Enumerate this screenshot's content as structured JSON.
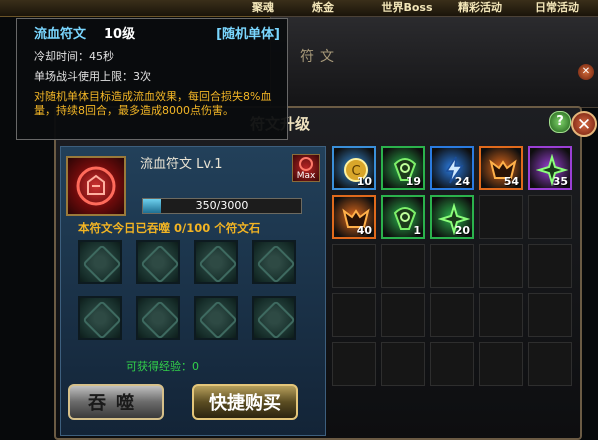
{
  "top_tabs": [
    "聚魂",
    "炼金",
    "世界Boss",
    "精彩活动",
    "日常活动"
  ],
  "back_window": {
    "title": "符文",
    "close_icon": "close-icon"
  },
  "window": {
    "title": "符文升级",
    "help_label": "?",
    "close_label": "✕"
  },
  "rune": {
    "name": "流血符文 Lv.1",
    "max_label": "Max",
    "exp_text": "350/3000",
    "exp_progress": 0.1167,
    "devour_info": "本符文今日已吞噬 0/100 个符文石",
    "exp_gain": "可获得经验：0"
  },
  "buttons": {
    "devour": "吞噬",
    "quick_buy": "快捷购买"
  },
  "inventory": [
    {
      "icon": "gold-coin-rune-icon",
      "count": "10",
      "color": "#3a8fd9"
    },
    {
      "icon": "green-swirl-rune-icon",
      "count": "19",
      "color": "#2bb24c"
    },
    {
      "icon": "blue-lightning-rune-icon",
      "count": "24",
      "color": "#2a7be0"
    },
    {
      "icon": "orange-demon-rune-icon",
      "count": "54",
      "color": "#e06a1c"
    },
    {
      "icon": "green-shuriken-rune-icon",
      "count": "35",
      "color": "#9b3fd6"
    },
    {
      "icon": "orange-demon-rune-icon",
      "count": "40",
      "color": "#e06a1c"
    },
    {
      "icon": "green-swirl-rune-icon",
      "count": "1",
      "color": "#2bb24c"
    },
    {
      "icon": "green-shuriken-rune-icon",
      "count": "20",
      "color": "#2bb24c"
    }
  ],
  "tooltip": {
    "name": "流血符文",
    "level": "10级",
    "type": "[随机单体]",
    "cooldown": "冷却时间：45秒",
    "limit": "单场战斗使用上限：3次",
    "description": "对随机单体目标造成流血效果，每回合损失8%血量，持续8回合，最多造成8000点伤害。"
  }
}
